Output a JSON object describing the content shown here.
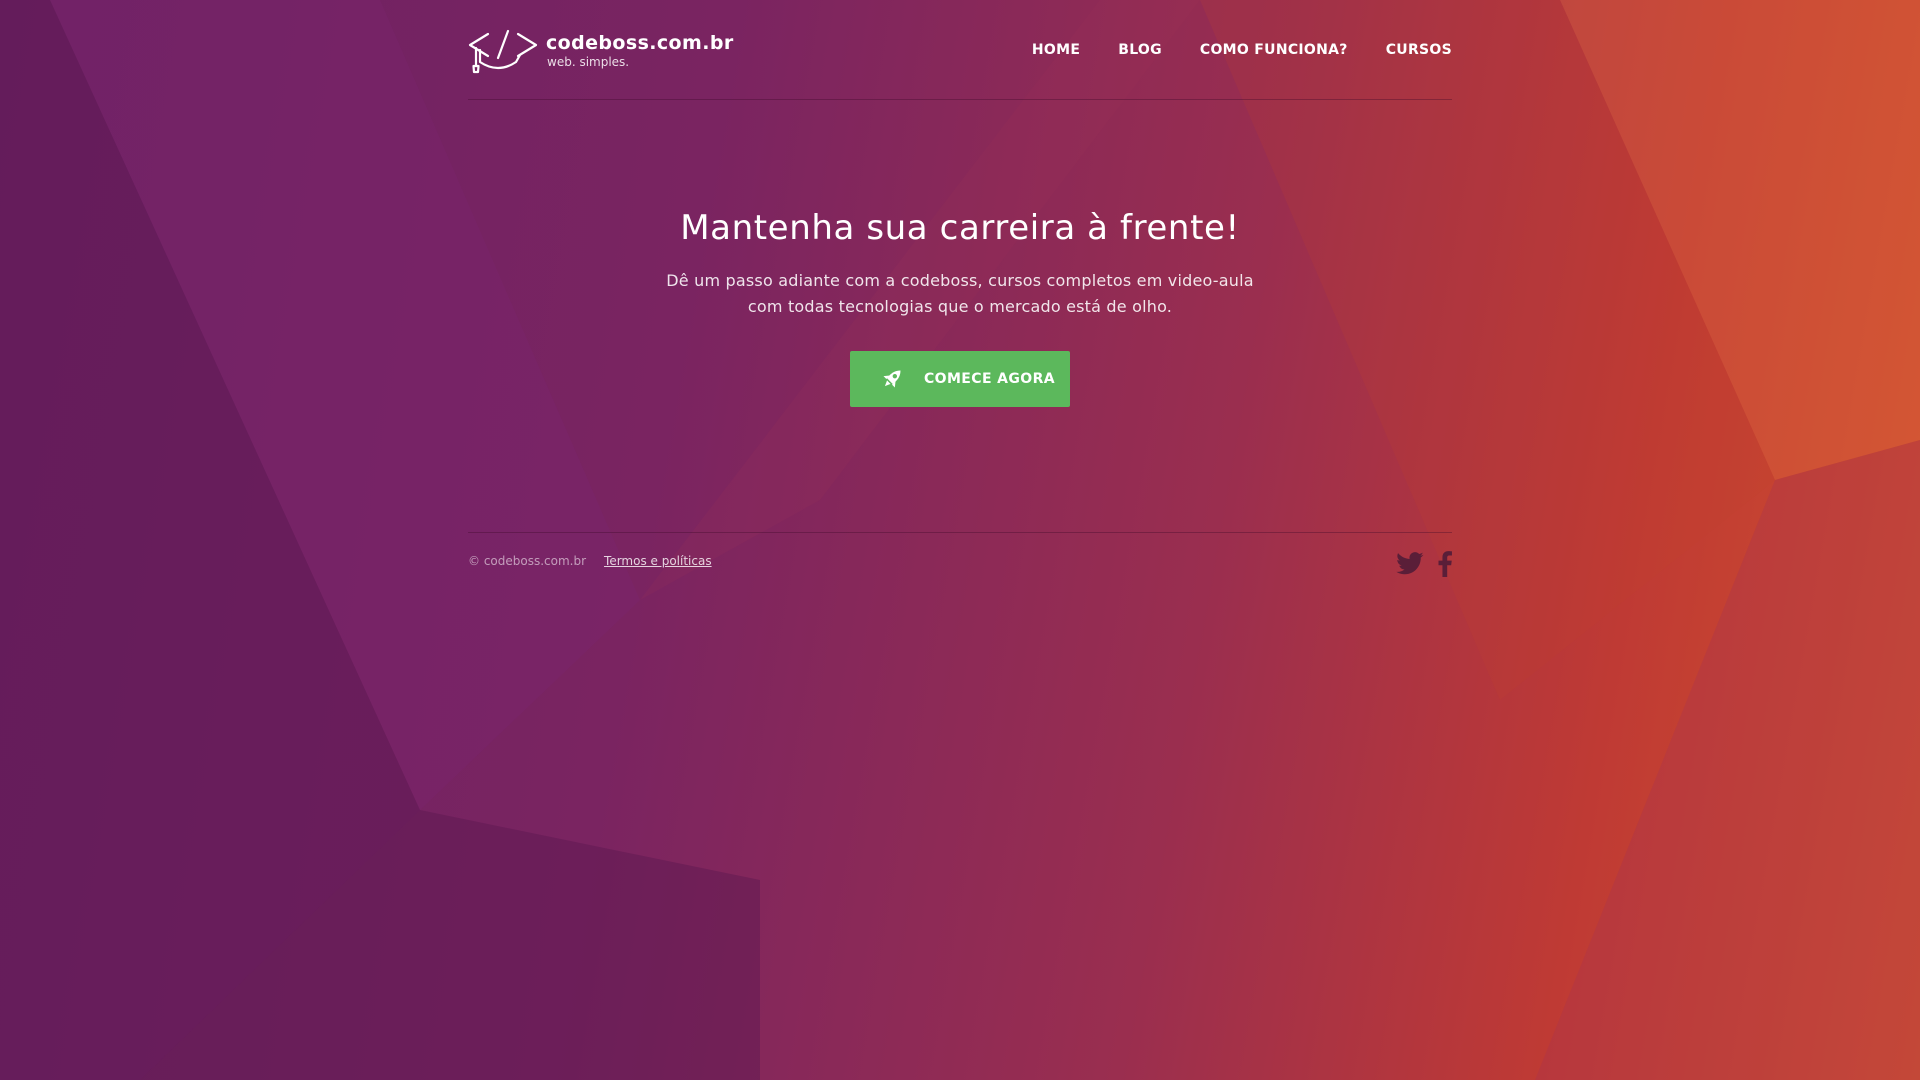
{
  "brand": {
    "name": "codeboss.com.br",
    "tagline": "web. simples.",
    "logo_icon": "graduation-cap-code-icon"
  },
  "nav": {
    "items": [
      {
        "label": "HOME"
      },
      {
        "label": "BLOG"
      },
      {
        "label": "COMO FUNCIONA?"
      },
      {
        "label": "CURSOS"
      }
    ]
  },
  "hero": {
    "title": "Mantenha sua carreira à frente!",
    "subtitle_line1": "Dê um passo adiante com a codeboss, cursos completos em video-aula",
    "subtitle_line2": "com todas tecnologias que o mercado está de olho.",
    "cta_label": "COMECE AGORA",
    "cta_icon": "rocket-icon"
  },
  "footer": {
    "copyright": "© codeboss.com.br",
    "terms_link": "Termos e políticas",
    "social": [
      {
        "icon": "twitter-icon"
      },
      {
        "icon": "facebook-icon"
      }
    ]
  },
  "colors": {
    "cta": "#5cb85c",
    "background_left": "#6c2163",
    "background_right": "#d2532c",
    "social_icon": "#5a1e38"
  }
}
